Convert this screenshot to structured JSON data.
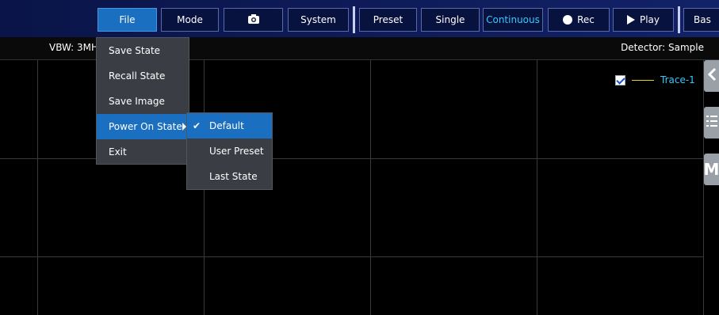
{
  "toolbar": {
    "file": "File",
    "mode": "Mode",
    "camera_icon": "camera-icon",
    "system": "System",
    "preset": "Preset",
    "single": "Single",
    "continuous": "Continuous",
    "rec": "Rec",
    "play": "Play",
    "bas": "Bas"
  },
  "status": {
    "vbw": "VBW: 3MH",
    "detector": "Detector: Sample"
  },
  "file_menu": {
    "items": [
      "Save State",
      "Recall State",
      "Save Image",
      "Power On State",
      "Exit"
    ]
  },
  "power_on_submenu": {
    "items": [
      "Default",
      "User Preset",
      "Last State"
    ],
    "checked": "Default"
  },
  "trace": {
    "label": "Trace-1",
    "checked": true,
    "line_color": "#e8d020"
  },
  "side_tabs": {
    "collapse_icon": "chevron-left-icon",
    "list_icon": "list-icon",
    "marker_label": "M"
  },
  "colors": {
    "accent": "#1a6fc0",
    "toolbar_bg": "#0a1448",
    "trace_text": "#38c8ff"
  }
}
